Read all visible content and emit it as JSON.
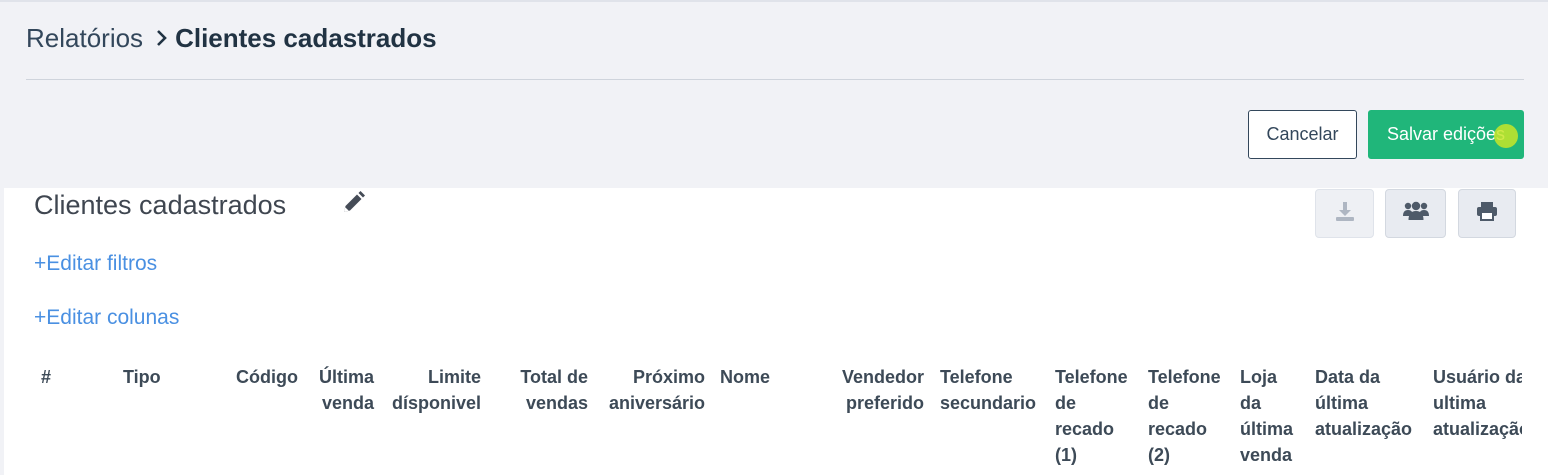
{
  "breadcrumb": {
    "parent": "Relatórios",
    "current": "Clientes cadastrados"
  },
  "actions": {
    "cancel_label": "Cancelar",
    "save_label": "Salvar edições"
  },
  "report": {
    "title": "Clientes cadastrados",
    "edit_filters": "+Editar filtros",
    "edit_columns": "+Editar colunas",
    "toolbar_icons": [
      "download-icon",
      "users-icon",
      "print-icon"
    ]
  },
  "table": {
    "columns": [
      {
        "id": "num",
        "lines": [
          "#"
        ]
      },
      {
        "id": "tipo",
        "lines": [
          "Tipo"
        ]
      },
      {
        "id": "codigo",
        "lines": [
          "Código"
        ]
      },
      {
        "id": "ultima-venda",
        "lines": [
          "Última",
          "venda"
        ]
      },
      {
        "id": "limite",
        "lines": [
          "Limite",
          "dísponivel"
        ]
      },
      {
        "id": "total-vendas",
        "lines": [
          "Total de",
          "vendas"
        ]
      },
      {
        "id": "proximo-aniversario",
        "lines": [
          "Próximo",
          "aniversário"
        ]
      },
      {
        "id": "nome",
        "lines": [
          "Nome"
        ]
      },
      {
        "id": "vendedor",
        "lines": [
          "Vendedor",
          "preferido"
        ]
      },
      {
        "id": "telefone-secundario",
        "lines": [
          "Telefone",
          "secundario"
        ]
      },
      {
        "id": "telefone-recado-1",
        "lines": [
          "Telefone",
          "de",
          "recado",
          "(1)"
        ]
      },
      {
        "id": "telefone-recado-2",
        "lines": [
          "Telefone",
          "de",
          "recado",
          "(2)"
        ]
      },
      {
        "id": "loja-ultima-venda",
        "lines": [
          "Loja",
          "da",
          "última",
          "venda"
        ]
      },
      {
        "id": "data-atualizacao",
        "lines": [
          "Data da",
          "última",
          "atualização"
        ]
      },
      {
        "id": "usuario-atualizacao",
        "lines": [
          "Usuário da",
          "ultima",
          "atualização"
        ]
      }
    ]
  },
  "colors": {
    "accent_green": "#20b67a",
    "link_blue": "#4a90e2",
    "page_bg": "#f1f2f6"
  }
}
